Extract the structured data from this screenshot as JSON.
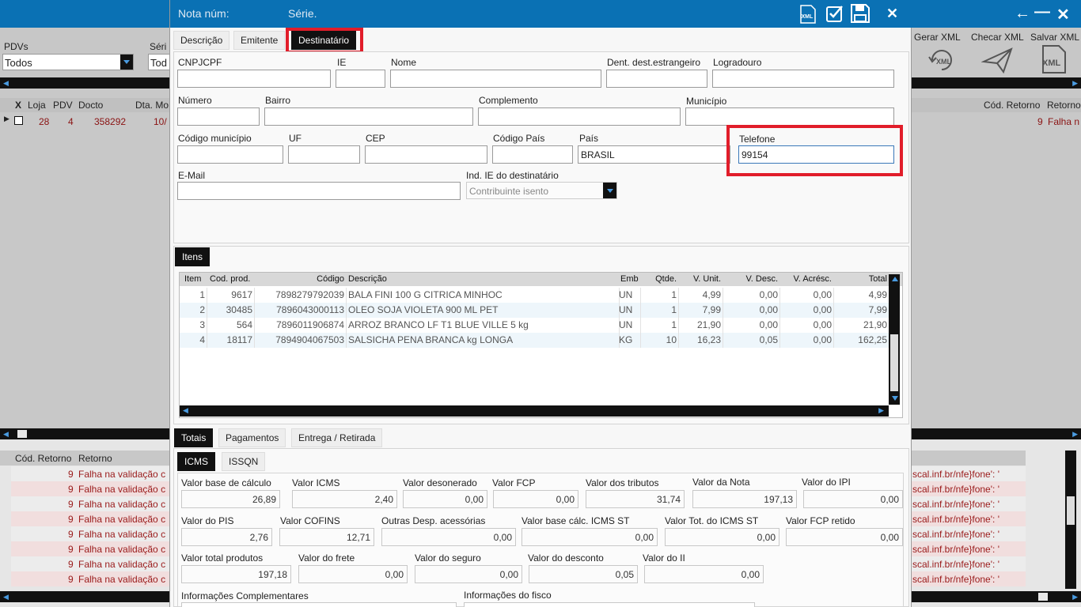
{
  "bg": {
    "window_buttons": {
      "back": "←",
      "minimize": "—",
      "close": "✕"
    },
    "filters": {
      "pdvs_label": "PDVs",
      "pdvs_value": "Todos",
      "serie_label": "Séri",
      "serie_value": "Tod"
    },
    "toolbar": {
      "gerar_xml": "Gerar XML",
      "checar_xml": "Checar XML",
      "salvar_xml": "Salvar XML",
      "xml_icon_text": "XML"
    },
    "grid": {
      "headers": {
        "x": "X",
        "loja": "Loja",
        "pdv": "PDV",
        "docto": "Docto",
        "dta": "Dta. Mo",
        "cod_retorno": "Cód. Retorno",
        "retorno": "Retorno"
      },
      "row": {
        "loja": "28",
        "pdv": "4",
        "docto": "358292",
        "dta": "10/",
        "cod": "9",
        "retorno": "Falha n"
      }
    },
    "log": {
      "header_cod": "Cód. Retorno",
      "header_ret": "Retorno",
      "rows": [
        {
          "cod": "9",
          "text": "Falha na validação c",
          "tail": "scal.inf.br/nfe}fone': '"
        },
        {
          "cod": "9",
          "text": "Falha na validação c",
          "tail": "scal.inf.br/nfe}fone': '"
        },
        {
          "cod": "9",
          "text": "Falha na validação c",
          "tail": "scal.inf.br/nfe}fone': '"
        },
        {
          "cod": "9",
          "text": "Falha na validação c",
          "tail": "scal.inf.br/nfe}fone': '"
        },
        {
          "cod": "9",
          "text": "Falha na validação c",
          "tail": "scal.inf.br/nfe}fone': '"
        },
        {
          "cod": "9",
          "text": "Falha na validação c",
          "tail": "scal.inf.br/nfe}fone': '"
        },
        {
          "cod": "9",
          "text": "Falha na validação c",
          "tail": "scal.inf.br/nfe}fone': '"
        },
        {
          "cod": "9",
          "text": "Falha na validação c",
          "tail": "scal.inf.br/nfe}fone': '"
        }
      ]
    }
  },
  "dialog": {
    "title": {
      "nota": "Nota núm:",
      "serie": "Série."
    },
    "title_icons": {
      "xml": "XML",
      "close": "✕"
    },
    "tabs": [
      "Descrição",
      "Emitente",
      "Destinatário"
    ],
    "fields": {
      "cnpjcpf": {
        "label": "CNPJCPF",
        "value": ""
      },
      "ie": {
        "label": "IE",
        "value": ""
      },
      "nome": {
        "label": "Nome",
        "value": ""
      },
      "ident_estrangeiro": {
        "label": "Dent. dest.estrangeiro",
        "value": ""
      },
      "logradouro": {
        "label": "Logradouro",
        "value": ""
      },
      "numero": {
        "label": "Número",
        "value": ""
      },
      "bairro": {
        "label": "Bairro",
        "value": ""
      },
      "complemento": {
        "label": "Complemento",
        "value": ""
      },
      "municipio": {
        "label": "Município",
        "value": ""
      },
      "codigo_municipio": {
        "label": "Código município",
        "value": ""
      },
      "uf": {
        "label": "UF",
        "value": ""
      },
      "cep": {
        "label": "CEP",
        "value": ""
      },
      "codigo_pais": {
        "label": "Código País",
        "value": ""
      },
      "pais": {
        "label": "País",
        "value": "BRASIL"
      },
      "telefone": {
        "label": "Telefone",
        "value": "99154"
      },
      "email": {
        "label": "E-Mail",
        "value": ""
      },
      "ind_ie": {
        "label": "Ind. IE do destinatário",
        "value": "Contribuinte isento"
      }
    },
    "itens": {
      "tab": "Itens",
      "headers": [
        "Item",
        "Cod. prod.",
        "Código",
        "Descrição",
        "Emb",
        "Qtde.",
        "V. Unit.",
        "V. Desc.",
        "V. Acrésc.",
        "Total"
      ],
      "rows": [
        [
          "1",
          "9617",
          "7898279792039",
          "BALA FINI 100 G CITRICA MINHOC",
          "UN",
          "1",
          "4,99",
          "0,00",
          "0,00",
          "4,99"
        ],
        [
          "2",
          "30485",
          "7896043000113",
          "OLEO SOJA VIOLETA 900 ML PET",
          "UN",
          "1",
          "7,99",
          "0,00",
          "0,00",
          "7,99"
        ],
        [
          "3",
          "564",
          "7896011906874",
          "ARROZ BRANCO LF T1 BLUE VILLE 5 kg",
          "UN",
          "1",
          "21,90",
          "0,00",
          "0,00",
          "21,90"
        ],
        [
          "4",
          "18117",
          "7894904067503",
          "SALSICHA PENA BRANCA kg LONGA",
          "KG",
          "10",
          "16,23",
          "0,05",
          "0,00",
          "162,25"
        ]
      ]
    },
    "bottom_tabs": [
      "Totais",
      "Pagamentos",
      "Entrega / Retirada"
    ],
    "sub_tabs": [
      "ICMS",
      "ISSQN"
    ],
    "totais": {
      "base_calculo": {
        "label": "Valor base de cálculo",
        "value": "26,89"
      },
      "valor_icms": {
        "label": "Valor ICMS",
        "value": "2,40"
      },
      "desonerado": {
        "label": "Valor desonerado",
        "value": "0,00"
      },
      "fcp": {
        "label": "Valor FCP",
        "value": "0,00"
      },
      "tributos": {
        "label": "Valor dos tributos",
        "value": "31,74"
      },
      "valor_nota": {
        "label": "Valor da Nota",
        "value": "197,13"
      },
      "ipi": {
        "label": "Valor do IPI",
        "value": "0,00"
      },
      "pis": {
        "label": "Valor do PIS",
        "value": "2,76"
      },
      "cofins": {
        "label": "Valor COFINS",
        "value": "12,71"
      },
      "outras": {
        "label": "Outras Desp. acessórias",
        "value": "0,00"
      },
      "base_st": {
        "label": "Valor base cálc.  ICMS ST",
        "value": "0,00"
      },
      "tot_icms_st": {
        "label": "Valor Tot. do ICMS ST",
        "value": "0,00"
      },
      "fcp_retido": {
        "label": "Valor FCP retido",
        "value": "0,00"
      },
      "total_produtos": {
        "label": "Valor total produtos",
        "value": "197,18"
      },
      "frete": {
        "label": "Valor do frete",
        "value": "0,00"
      },
      "seguro": {
        "label": "Valor do seguro",
        "value": "0,00"
      },
      "desconto": {
        "label": "Valor do desconto",
        "value": "0,05"
      },
      "ii": {
        "label": "Valor do II",
        "value": "0,00"
      },
      "info_comp": {
        "label": "Informações Complementares"
      },
      "info_fisco": {
        "label": "Informações do fisco"
      }
    }
  }
}
